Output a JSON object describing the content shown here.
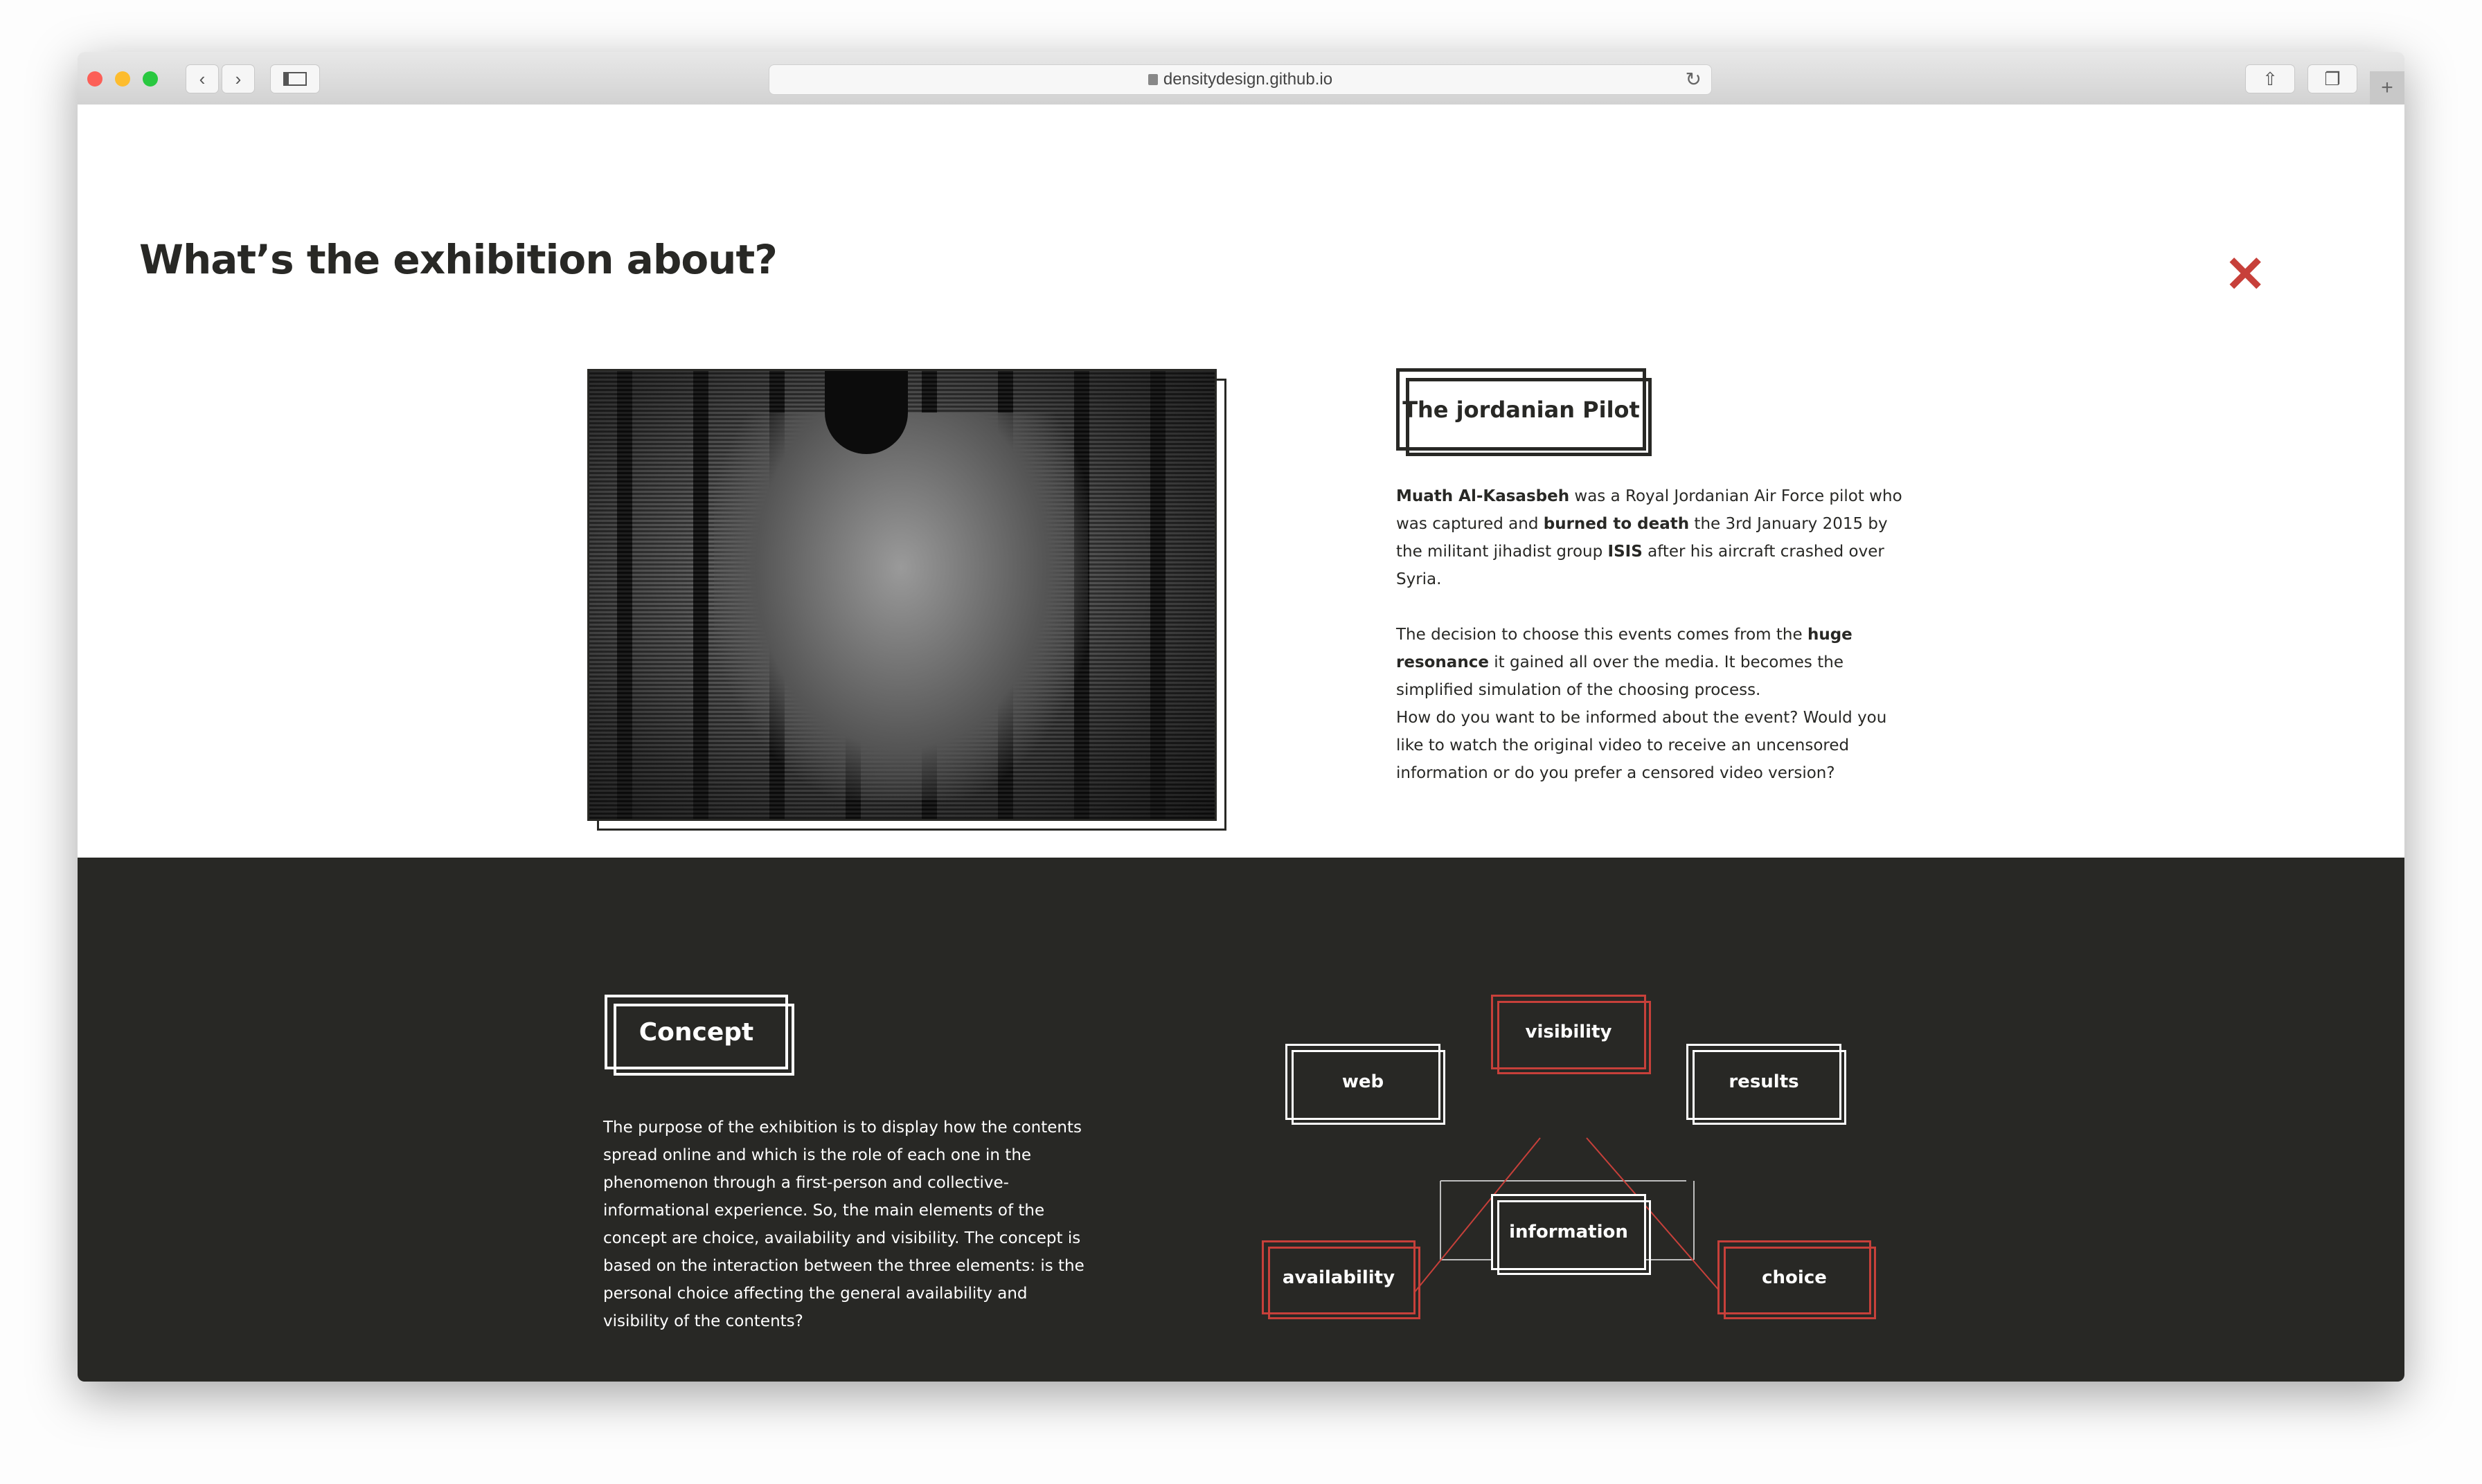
{
  "browser": {
    "url": "densitydesign.github.io",
    "icons": [
      "close-light",
      "minimize-light",
      "zoom-light",
      "back-icon",
      "forward-icon",
      "sidebar-icon",
      "lock-icon",
      "reload-icon",
      "share-icon",
      "tabs-icon",
      "new-tab-icon"
    ]
  },
  "header": {
    "title": "What’s the exhibition about?",
    "close_icon": "close-x-icon",
    "accent": "#c7403a"
  },
  "pilot": {
    "heading": "The jordanian Pilot",
    "p1": {
      "b1": "Muath Al-Kasasbeh",
      "t1": " was a Royal Jordanian Air Force pilot who was captured and ",
      "b2": "burned to death",
      "t2": " the 3rd January 2015 by the militant jihadist group ",
      "b3": "ISIS",
      "t3": " after his aircraft crashed over Syria."
    },
    "p2": {
      "t1": "The decision to choose this events comes from the ",
      "b1": "huge resonance",
      "t2": " it gained all over the media. It becomes the simplified simulation of the choosing process.",
      "t3": "How do you want to be informed about the event? Would you like to watch the original video to receive an uncensored information or do you prefer a censored video version?"
    }
  },
  "concept": {
    "heading": "Concept",
    "text": "The purpose of the exhibition is to display how the contents spread online and which is the role of each one in the phenomenon through a first-person and collective-informational experience. So, the main elements of the concept are choice, availability and visibility. The concept is based on the interaction between the three elements: is the personal choice affecting the general availability and visibility of the contents?"
  },
  "diagram": {
    "nodes": {
      "visibility": "visibility",
      "web": "web",
      "results": "results",
      "information": "information",
      "availability": "availability",
      "choice": "choice"
    },
    "colors": {
      "highlight": "#c7403a",
      "normal": "#ffffff",
      "background": "#282825"
    }
  }
}
